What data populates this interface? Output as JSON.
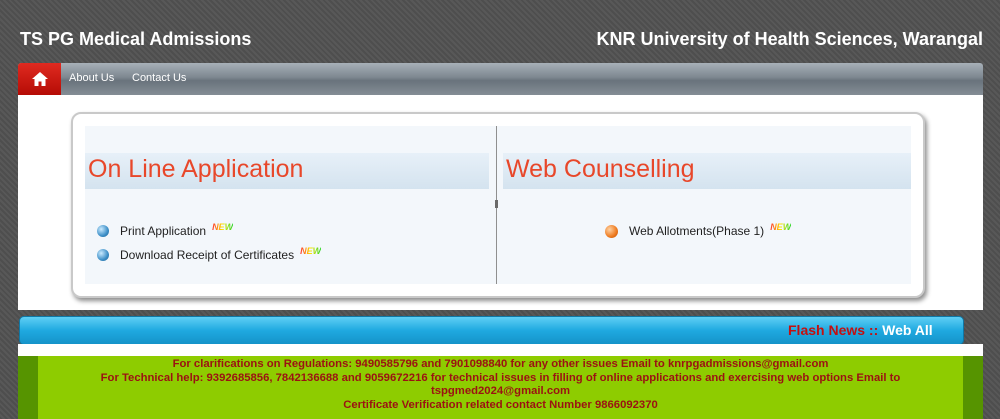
{
  "header": {
    "title_left": "TS PG Medical Admissions",
    "title_right": "KNR University of Health Sciences, Warangal"
  },
  "nav": {
    "home_icon": "home-icon",
    "items": [
      {
        "label": "About Us"
      },
      {
        "label": "Contact Us"
      }
    ]
  },
  "online_application": {
    "title": "On Line Application",
    "links": [
      {
        "label": "Print Application",
        "badge": "NEW"
      },
      {
        "label": "Download Receipt of Certificates",
        "badge": "NEW"
      }
    ]
  },
  "web_counselling": {
    "title": "Web Counselling",
    "links": [
      {
        "label": "Web Allotments(Phase 1)",
        "badge": "NEW"
      }
    ]
  },
  "flash": {
    "label": "Flash News :: ",
    "message": "Web All"
  },
  "info": {
    "lines": [
      "For clarifications on Regulations: 9490585796 and 7901098840 for any other issues Email to knrpgadmissions@gmail.com",
      "For Technical help: 9392685856, 7842136688 and 9059672216 for technical issues in filling of online applications and exercising web options Email to",
      "tspgmed2024@gmail.com",
      "Certificate Verification related contact Number 9866092370"
    ]
  },
  "colors": {
    "accent_red": "#e8472a",
    "flash_blue": "#1fa9e0",
    "info_green": "#8ecc00",
    "info_text": "#9b1212"
  }
}
